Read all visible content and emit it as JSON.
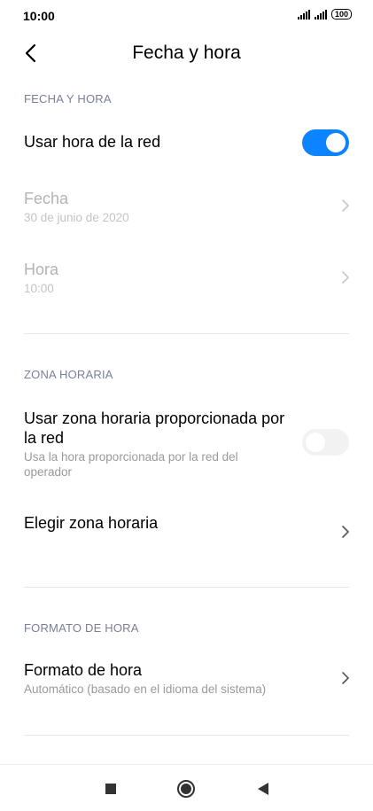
{
  "status_bar": {
    "time": "10:00",
    "battery": "100"
  },
  "header": {
    "title": "Fecha y hora"
  },
  "sections": {
    "date_time": {
      "header": "FECHA Y HORA",
      "network_time": {
        "title": "Usar hora de la red",
        "enabled": true
      },
      "date": {
        "title": "Fecha",
        "value": "30 de junio de 2020"
      },
      "time": {
        "title": "Hora",
        "value": "10:00"
      }
    },
    "time_zone": {
      "header": "ZONA HORARIA",
      "network_zone": {
        "title_line1": "Usar zona horaria proporcionada por",
        "title_line2": "la red",
        "sub_line1": "Usa la hora proporcionada por la red del",
        "sub_line2": "operador",
        "enabled": false
      },
      "choose_zone": {
        "title": "Elegir zona horaria"
      }
    },
    "time_format": {
      "header": "FORMATO DE HORA",
      "format": {
        "title": "Formato de hora",
        "value": "Automático (basado en el idioma del sistema)"
      }
    }
  },
  "icons": {
    "back": "back-arrow-icon",
    "chevron": "chevron-right-icon",
    "nav_recents": "square-icon",
    "nav_home": "circle-icon",
    "nav_back": "triangle-back-icon"
  },
  "colors": {
    "accent": "#0d84ff",
    "section_header": "#7a7f99",
    "disabled_text": "#b3b3b3"
  }
}
